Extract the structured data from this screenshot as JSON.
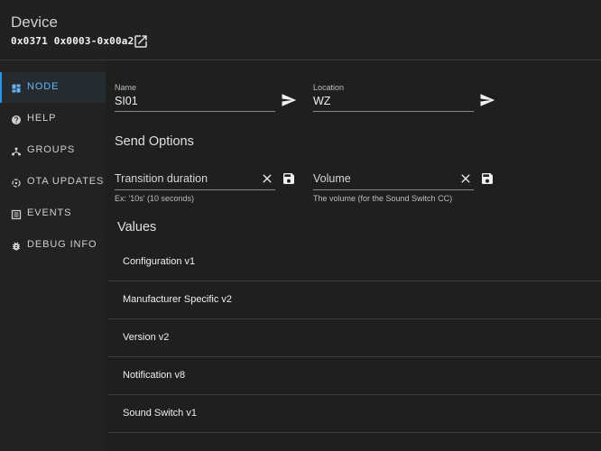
{
  "header": {
    "title": "Device",
    "subtitle": "0x0371 0x0003-0x00a2"
  },
  "sidebar": {
    "items": [
      {
        "label": "NODE",
        "icon": "grid-icon",
        "active": true
      },
      {
        "label": "HELP",
        "icon": "help-circle-icon"
      },
      {
        "label": "GROUPS",
        "icon": "groups-icon"
      },
      {
        "label": "OTA UPDATES",
        "icon": "refresh-icon"
      },
      {
        "label": "EVENTS",
        "icon": "list-icon"
      },
      {
        "label": "DEBUG INFO",
        "icon": "bug-icon"
      }
    ]
  },
  "node_fields": {
    "name": {
      "label": "Name",
      "value": "SI01"
    },
    "location": {
      "label": "Location",
      "value": "WZ"
    }
  },
  "send_options": {
    "title": "Send Options",
    "transition": {
      "placeholder": "Transition duration",
      "hint": "Ex: '10s' (10 seconds)"
    },
    "volume": {
      "placeholder": "Volume",
      "hint": "The volume (for the Sound Switch CC)"
    }
  },
  "values": {
    "title": "Values",
    "items": [
      "Configuration v1",
      "Manufacturer Specific v2",
      "Version v2",
      "Notification v8",
      "Sound Switch v1"
    ]
  },
  "colors": {
    "accent": "#2196f3",
    "background": "#1f1f1f"
  }
}
